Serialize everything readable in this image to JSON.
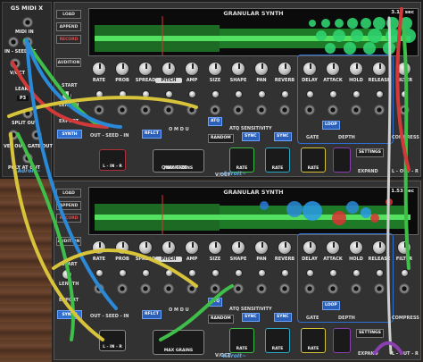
{
  "midi_module": {
    "title": "GS MIDI X",
    "midi_in": "MIDI IN",
    "in_seed": "IN - SEED - C",
    "voct_out": "V/OCT",
    "leak": "LEAK",
    "p3": "P3",
    "split_out": "SPLIT OUT",
    "vel_out": "VEL OUT",
    "gate_out": "GATE OUT",
    "poly_at_out": "POLY AT OUT",
    "brand": "~AdroIt~"
  },
  "synth1": {
    "side_buttons": {
      "load": "LOAD",
      "append": "APPEND",
      "record": "RECORD",
      "audition": "AUDITION"
    },
    "display_title": "GRANULAR SYNTH",
    "display_time": "3.18 sec",
    "side_labels": {
      "start": "START",
      "length": "LENGTH",
      "export": "EXPORT",
      "synth": "SYNTH"
    },
    "knobs": [
      "RATE",
      "PROB",
      "SPREAD",
      "PITCH",
      "AMP",
      "SIZE",
      "SHAPE",
      "PAN",
      "REVERB",
      "DELAY",
      "ATTACK",
      "HOLD",
      "RELEASE",
      "FILTER"
    ],
    "highlighted_knob": "PITCH",
    "controls": {
      "atq": "ATQ",
      "atq_sensitivity": "ATQ SENSITIVITY",
      "random": "RANDOM",
      "sync1": "SYNC",
      "sync2": "SYNC",
      "loop": "LOOP",
      "gate": "GATE",
      "depth": "DEPTH",
      "compress": "COMPRESS",
      "settings": "SETTINGS",
      "expand": "EXPAND",
      "out_seed_in": "OUT - SEED - IN",
      "rflct": "RFLCT",
      "omdu": "O M D U",
      "quantize": "QUANTIZE",
      "voct": "V/OCT",
      "l_in_r": "L - IN - R",
      "max_grains": "MAX GRAINS",
      "l_out_r": "L - OUT - R",
      "rate": "RATE"
    },
    "brand": "~AdroIt~"
  },
  "synth2": {
    "side_buttons": {
      "load": "LOAD",
      "append": "APPEND",
      "record": "RECORD",
      "audition": "AUDITION"
    },
    "display_title": "GRANULAR SYNTH",
    "display_time": "1.53 sec",
    "side_labels": {
      "start": "START",
      "length": "LENGTH",
      "export": "EXPORT",
      "synth": "SYNTH"
    },
    "knobs": [
      "RATE",
      "PROB",
      "SPREAD",
      "PITCH",
      "AMP",
      "SIZE",
      "SHAPE",
      "PAN",
      "REVERB",
      "DELAY",
      "ATTACK",
      "HOLD",
      "RELEASE",
      "FILTER"
    ],
    "highlighted_knob": "PITCH",
    "controls": {
      "atq": "ATQ",
      "atq_sensitivity": "ATQ SENSITIVITY",
      "random": "RANDOM",
      "sync1": "SYNC",
      "sync2": "SYNC",
      "loop": "LOOP",
      "gate": "GATE",
      "depth": "DEPTH",
      "compress": "COMPRESS",
      "settings": "SETTINGS",
      "expand": "EXPAND",
      "out_seed_in": "OUT - SEED - IN",
      "rflct": "RFLCT",
      "omdu": "O M D U",
      "quantize": "QUANTIZE",
      "voct": "V/OCT",
      "l_in_r": "L - IN - R",
      "max_grains": "MAX GRAINS",
      "l_out_r": "L - OUT - R",
      "rate": "RATE"
    },
    "brand": "~AdroIt~"
  },
  "colors": {
    "accent_blue": "#2d6fd6",
    "cable_green": "#3fbf4a",
    "cable_yellow": "#d8c43a",
    "cable_red": "#d23a3a",
    "cable_blue": "#2a8ad8",
    "cable_purple": "#8a3fb0",
    "waveform": "#3fc04a"
  }
}
